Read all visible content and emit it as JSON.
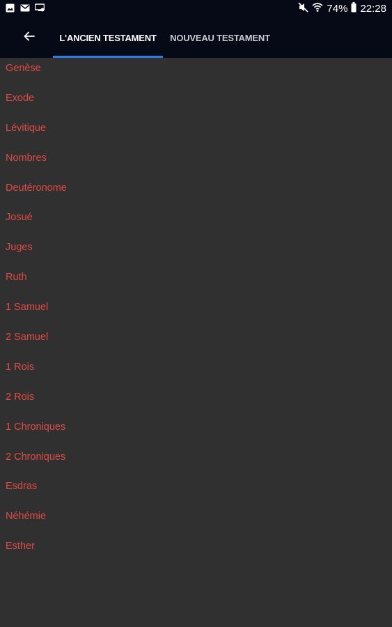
{
  "status_bar": {
    "battery": "74%",
    "time": "22:28",
    "left_icons": [
      "gallery-icon",
      "mail-icon",
      "cast-icon"
    ],
    "right_icons": [
      "mute-icon",
      "wifi-icon",
      "battery-icon"
    ]
  },
  "header": {
    "back_icon": "arrow-left-icon",
    "tabs": [
      {
        "label": "L'ANCIEN TESTAMENT",
        "active": true
      },
      {
        "label": "NOUVEAU TESTAMENT",
        "active": false
      }
    ]
  },
  "colors": {
    "background": "#303030",
    "appbar": "#060a16",
    "accent": "#2a7be6",
    "book_text": "#e04a45"
  },
  "books": [
    "Genèse",
    "Exode",
    "Lévitique",
    "Nombres",
    "Deutéronome",
    "Josué",
    "Juges",
    "Ruth",
    "1 Samuel",
    "2 Samuel",
    "1 Rois",
    "2 Rois",
    "1 Chroniques",
    "2 Chroniques",
    "Esdras",
    "Néhémie",
    "Esther"
  ]
}
